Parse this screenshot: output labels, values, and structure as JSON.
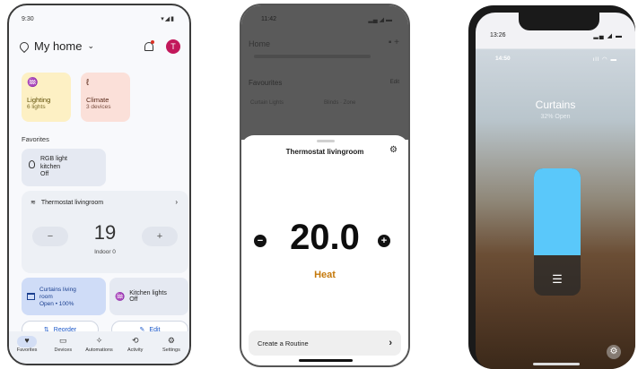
{
  "phone1": {
    "status_time": "9:30",
    "status_icons": "▾◢▮",
    "home_title": "My home",
    "avatar_initial": "T",
    "tiles": [
      {
        "name": "Lighting",
        "sub": "6 lights",
        "icon": "lightbulb-icon"
      },
      {
        "name": "Climate",
        "sub": "3 devices",
        "icon": "thermometer-icon"
      }
    ],
    "favorites_heading": "Favorites",
    "rgb": {
      "name": "RGB light kitchen",
      "status": "Off"
    },
    "thermostat": {
      "name": "Thermostat livingroom",
      "value": "19",
      "indoor": "Indoor 0",
      "minus": "−",
      "plus": "+"
    },
    "curtains": {
      "name": "Curtains living room",
      "status": "Open • 100%"
    },
    "kitchen_lights": {
      "name": "Kitchen lights",
      "status": "Off"
    },
    "reorder_label": "Reorder",
    "edit_label": "Edit",
    "nav": [
      {
        "label": "Favorites",
        "icon": "♥"
      },
      {
        "label": "Devices",
        "icon": "▭"
      },
      {
        "label": "Automations",
        "icon": "✧"
      },
      {
        "label": "Activity",
        "icon": "⟲"
      },
      {
        "label": "Settings",
        "icon": "⚙"
      }
    ]
  },
  "phone2": {
    "status_time": "11:42",
    "status_icons": "▂▄ ◢ ▬",
    "bg_home": "Home",
    "bg_favourites": "Favourites",
    "bg_edit": "Edit",
    "bg_card1": "Curtain Lights",
    "bg_card2": "Blinds · Zone",
    "sheet_title": "Thermostat livingroom",
    "setpoint": "20.0",
    "mode": "Heat",
    "routine_label": "Create a Routine"
  },
  "phone3": {
    "outer_time": "13:26",
    "outer_icons": "▂▄ ◢ ▬",
    "inner_time": "14:50",
    "inner_icons": "ıll ◠ ▬",
    "title": "Curtains",
    "status": "32% Open",
    "open_fraction": 0.68,
    "accent": "#5ac8fa"
  }
}
